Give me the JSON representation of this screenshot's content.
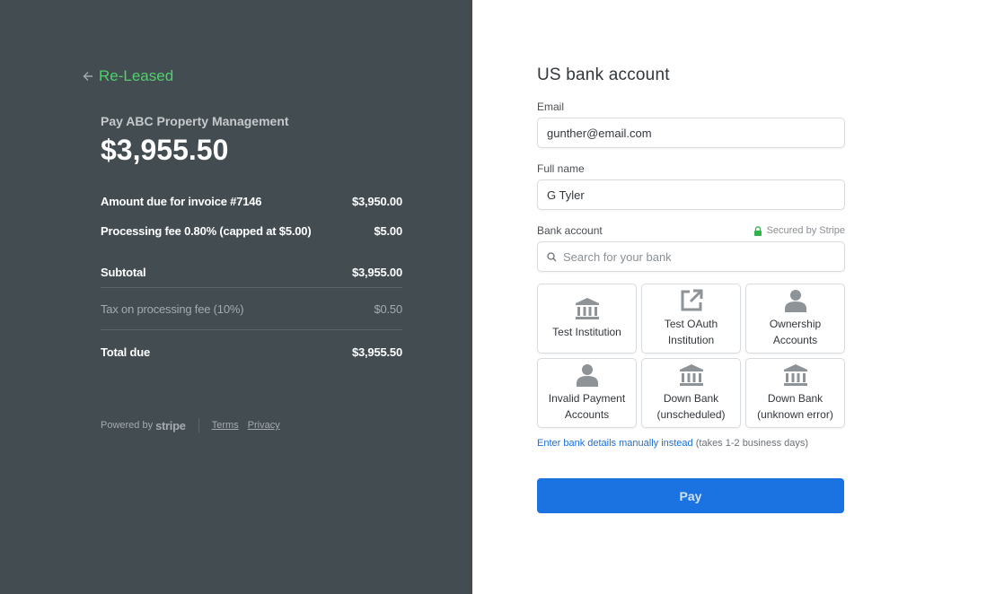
{
  "merchant": {
    "back_label": "Re-Leased",
    "pay_to": "Pay ABC Property Management",
    "total_display": "$3,955.50"
  },
  "line_items": [
    {
      "label": "Amount due for invoice #7146",
      "amount": "$3,950.00"
    },
    {
      "label": "Processing fee 0.80% (capped at $5.00)",
      "amount": "$5.00"
    }
  ],
  "subtotal": {
    "label": "Subtotal",
    "amount": "$3,955.00"
  },
  "tax": {
    "label": "Tax on processing fee (10%)",
    "amount": "$0.50"
  },
  "total": {
    "label": "Total due",
    "amount": "$3,955.50"
  },
  "footer": {
    "powered_by": "Powered by",
    "brand": "stripe",
    "terms": "Terms",
    "privacy": "Privacy"
  },
  "form": {
    "title": "US bank account",
    "email_label": "Email",
    "email_value": "gunther@email.com",
    "name_label": "Full name",
    "name_value": "G Tyler",
    "bank_label": "Bank account",
    "secured_label": "Secured by Stripe",
    "search_placeholder": "Search for your bank",
    "banks": [
      {
        "line1": "Test Institution",
        "line2": "",
        "icon": "bank-icon"
      },
      {
        "line1": "Test OAuth",
        "line2": "Institution",
        "icon": "external-link-icon"
      },
      {
        "line1": "Ownership",
        "line2": "Accounts",
        "icon": "person-icon"
      },
      {
        "line1": "Invalid Payment",
        "line2": "Accounts",
        "icon": "person-icon"
      },
      {
        "line1": "Down Bank",
        "line2": "(unscheduled)",
        "icon": "bank-icon"
      },
      {
        "line1": "Down Bank",
        "line2": "(unknown error)",
        "icon": "bank-icon"
      }
    ],
    "manual_link": "Enter bank details manually instead",
    "manual_note": " (takes 1-2 business days)",
    "pay_label": "Pay"
  },
  "colors": {
    "left_bg": "#434c51",
    "brand_green": "#4fd16b",
    "pay_blue": "#1a73e0",
    "link_blue": "#1a6ed8"
  }
}
